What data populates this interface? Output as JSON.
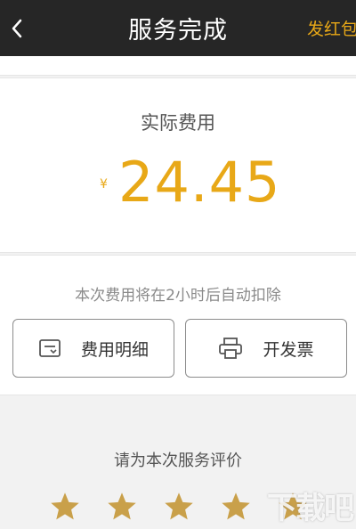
{
  "header": {
    "title": "服务完成",
    "action_label": "发红包",
    "back_icon": "chevron-left-icon"
  },
  "cost": {
    "label": "实际费用",
    "currency": "¥",
    "amount": "24.45"
  },
  "actions": {
    "notice": "本次费用将在2小时后自动扣除",
    "detail_label": "费用明细",
    "detail_icon": "receipt-icon",
    "invoice_label": "开发票",
    "invoice_icon": "printer-icon"
  },
  "rating": {
    "title": "请为本次服务评价",
    "stars_shown": 5
  },
  "watermark": "下载吧",
  "colors": {
    "header_bg": "#262626",
    "accent": "#e8a817",
    "star": "#c9a04a",
    "page_bg": "#f2f2f2"
  }
}
